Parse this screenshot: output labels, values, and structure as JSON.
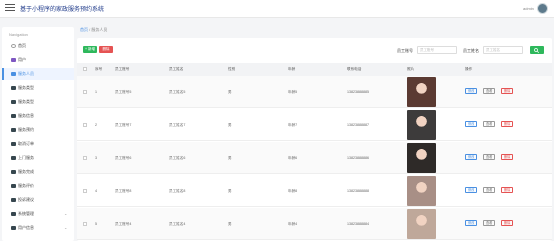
{
  "header": {
    "title": "基于小程序的家政服务预约系统",
    "user": "admin"
  },
  "sidebar": {
    "title": "Navigation",
    "items": [
      {
        "label": "首页",
        "icon": "circle-icon",
        "color": "#9e9e9e"
      },
      {
        "label": "用户",
        "icon": "users-icon",
        "color": "#7e57c2"
      },
      {
        "label": "服务人员",
        "icon": "staff-icon",
        "color": "#4a90e2",
        "active": true
      },
      {
        "label": "服务类型",
        "icon": "grid-icon",
        "color": "#37474f"
      },
      {
        "label": "服务类型",
        "icon": "grid-icon",
        "color": "#37474f"
      },
      {
        "label": "服务信息",
        "icon": "grid-icon",
        "color": "#37474f"
      },
      {
        "label": "服务预约",
        "icon": "grid-icon",
        "color": "#37474f"
      },
      {
        "label": "取消订单",
        "icon": "list-icon",
        "color": "#37474f"
      },
      {
        "label": "上门服务",
        "icon": "chat-icon",
        "color": "#37474f"
      },
      {
        "label": "服务完成",
        "icon": "doc-icon",
        "color": "#37474f"
      },
      {
        "label": "服务评价",
        "icon": "grid-icon",
        "color": "#37474f"
      },
      {
        "label": "投诉建议",
        "icon": "flag-icon",
        "color": "#37474f"
      },
      {
        "label": "系统管理",
        "icon": "settings-icon",
        "color": "#37474f",
        "chevron": "⌄"
      },
      {
        "label": "用户信息",
        "icon": "user-icon",
        "color": "#37474f",
        "chevron": "⌄"
      }
    ]
  },
  "breadcrumb": {
    "home": "首页",
    "sep": "/",
    "current": "服务人员"
  },
  "toolbar": {
    "add": "+ 新增",
    "delete": "删除"
  },
  "filters": [
    {
      "label": "员工账号",
      "placeholder": "员工账号"
    },
    {
      "label": "员工姓名",
      "placeholder": "员工姓名"
    }
  ],
  "table": {
    "columns": [
      "序号",
      "员工账号",
      "员工姓名",
      "性别",
      "年龄",
      "联系电话",
      "照片",
      "操作"
    ],
    "rows": [
      {
        "index": "1",
        "account": "员工账号5",
        "name": "员工姓名5",
        "gender": "男",
        "age": "年龄5",
        "phone": "13823888885",
        "photo_color": "#5b3a32"
      },
      {
        "index": "2",
        "account": "员工账号7",
        "name": "员工姓名7",
        "gender": "男",
        "age": "年龄7",
        "phone": "13823888887",
        "photo_color": "#3d3b3b"
      },
      {
        "index": "3",
        "account": "员工账号6",
        "name": "员工姓名6",
        "gender": "男",
        "age": "年龄6",
        "phone": "13823888886",
        "photo_color": "#2e2a28"
      },
      {
        "index": "4",
        "account": "员工账号8",
        "name": "员工姓名8",
        "gender": "男",
        "age": "年龄8",
        "phone": "13823888888",
        "photo_color": "#a88f86"
      },
      {
        "index": "5",
        "account": "员工账号4",
        "name": "员工姓名4",
        "gender": "男",
        "age": "年龄4",
        "phone": "13823888884",
        "photo_color": "#bfa89a"
      }
    ],
    "actions": {
      "edit": "修改",
      "view": "查看",
      "delete": "删除"
    }
  },
  "colors": {
    "accent": "#4a90e2",
    "success": "#2eb85c",
    "danger": "#e55353"
  }
}
